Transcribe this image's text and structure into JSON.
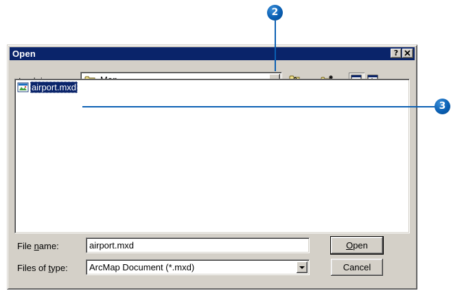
{
  "callouts": {
    "step2": "2",
    "step3": "3"
  },
  "dialog": {
    "title": "Open",
    "help_button": "?",
    "close_button": "×"
  },
  "look_in": {
    "label_pre": "Look ",
    "label_accel": "i",
    "label_post": "n:",
    "value": "Map",
    "icon": "folder-icon"
  },
  "toolbar": {
    "up_icon": "up-one-level-icon",
    "new_folder_icon": "new-folder-icon",
    "list_icon": "list-view-icon",
    "details_icon": "details-view-icon"
  },
  "files": [
    {
      "name": "airport.mxd",
      "icon": "map-document-icon",
      "selected": true
    }
  ],
  "file_name": {
    "label_pre": "File ",
    "label_accel": "n",
    "label_post": "ame:",
    "value": "airport.mxd"
  },
  "file_type": {
    "label_pre": "Files of ",
    "label_accel": "t",
    "label_post": "ype:",
    "value": "ArcMap Document (*.mxd)"
  },
  "buttons": {
    "open_accel": "O",
    "open_rest": "pen",
    "cancel": "Cancel"
  },
  "colors": {
    "titlebar": "#0a246a",
    "selection": "#0a246a",
    "callout": "#0a5fb3",
    "dialog_face": "#d4d0c8"
  }
}
